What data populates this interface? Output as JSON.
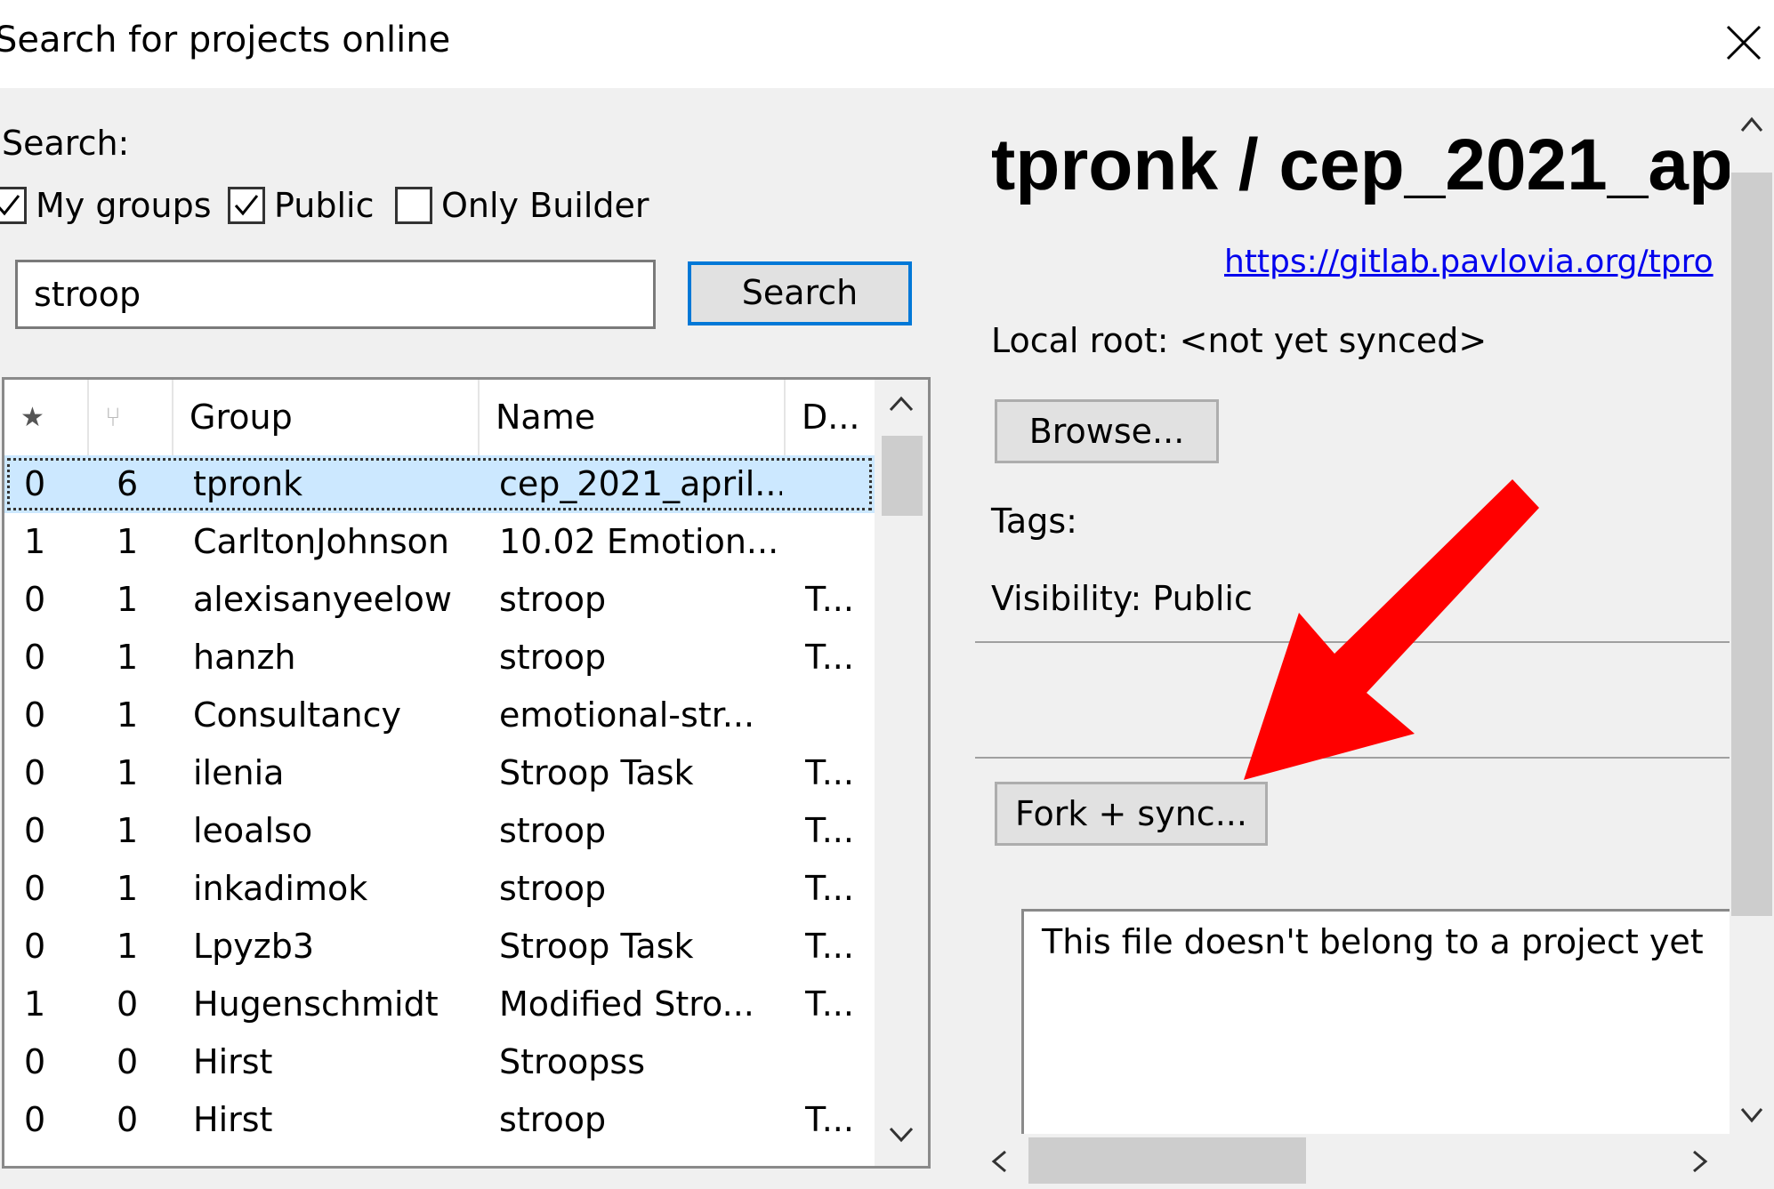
{
  "window": {
    "title": "Search for projects online",
    "close_icon": "close-icon"
  },
  "search": {
    "label": "Search:",
    "checkboxes": [
      {
        "label": "My groups",
        "checked": true
      },
      {
        "label": "Public",
        "checked": true
      },
      {
        "label": "Only Builder",
        "checked": false
      }
    ],
    "query": "stroop",
    "button_label": "Search"
  },
  "results": {
    "columns": [
      "★",
      "⑂",
      "Group",
      "Name",
      "D..."
    ],
    "rows": [
      {
        "stars": "0",
        "forks": "6",
        "group": "tpronk",
        "name": "cep_2021_april...",
        "desc": "",
        "selected": true
      },
      {
        "stars": "1",
        "forks": "1",
        "group": "CarltonJohnson",
        "name": "10.02 Emotion...",
        "desc": ""
      },
      {
        "stars": "0",
        "forks": "1",
        "group": "alexisanyeelow",
        "name": "stroop",
        "desc": "T..."
      },
      {
        "stars": "0",
        "forks": "1",
        "group": "hanzh",
        "name": "stroop",
        "desc": "T..."
      },
      {
        "stars": "0",
        "forks": "1",
        "group": "Consultancy",
        "name": "emotional-str...",
        "desc": ""
      },
      {
        "stars": "0",
        "forks": "1",
        "group": "ilenia",
        "name": "Stroop Task",
        "desc": "T..."
      },
      {
        "stars": "0",
        "forks": "1",
        "group": "leoalso",
        "name": "stroop",
        "desc": "T..."
      },
      {
        "stars": "0",
        "forks": "1",
        "group": "inkadimok",
        "name": "stroop",
        "desc": "T..."
      },
      {
        "stars": "0",
        "forks": "1",
        "group": "Lpyzb3",
        "name": "Stroop Task",
        "desc": "T..."
      },
      {
        "stars": "1",
        "forks": "0",
        "group": "Hugenschmidt",
        "name": "Modified Stro...",
        "desc": "T..."
      },
      {
        "stars": "0",
        "forks": "0",
        "group": "Hirst",
        "name": "Stroopss",
        "desc": ""
      },
      {
        "stars": "0",
        "forks": "0",
        "group": "Hirst",
        "name": "stroop",
        "desc": "T..."
      }
    ]
  },
  "detail": {
    "title": "tpronk / cep_2021_ap",
    "url": "https://gitlab.pavlovia.org/tpro",
    "local_root": "Local root: <not yet synced>",
    "browse_label": "Browse...",
    "tags_label": "Tags:",
    "visibility": "Visibility: Public",
    "fork_label": "Fork + sync...",
    "description": "This file doesn't belong to a project yet"
  },
  "colors": {
    "accent": "#0078d7",
    "selection": "#cce8ff",
    "annotation_arrow": "#ff0000",
    "link": "#0000ee"
  }
}
